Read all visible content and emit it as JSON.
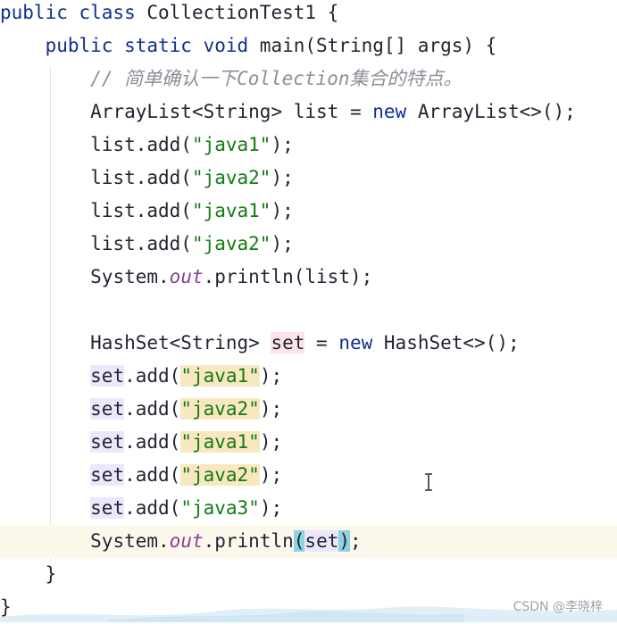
{
  "code": {
    "l1": {
      "kw": "public class ",
      "t": "CollectionTest1 {"
    },
    "l2": {
      "kw": "public static void ",
      "t": "main(String[] args) {"
    },
    "l3": {
      "comment": "// 简单确认一下Collection集合的特点。"
    },
    "l4": {
      "a": "ArrayList<String> list = ",
      "kw": "new",
      "b": " ArrayList<>();"
    },
    "l5": {
      "a": "list.add(",
      "s": "\"java1\"",
      "b": ");"
    },
    "l6": {
      "a": "list.add(",
      "s": "\"java2\"",
      "b": ");"
    },
    "l7": {
      "a": "list.add(",
      "s": "\"java1\"",
      "b": ");"
    },
    "l8": {
      "a": "list.add(",
      "s": "\"java2\"",
      "b": ");"
    },
    "l9": {
      "a": "System.",
      "f": "out",
      "b": ".println(list);"
    },
    "l11": {
      "a": "HashSet<String> ",
      "v": "set",
      "b": " = ",
      "kw": "new",
      "c": " HashSet<>();"
    },
    "l12": {
      "v": "set",
      "a": ".add(",
      "s": "\"java1\"",
      "b": ");"
    },
    "l13": {
      "v": "set",
      "a": ".add(",
      "s": "\"java2\"",
      "b": ");"
    },
    "l14": {
      "v": "set",
      "a": ".add(",
      "s": "\"java1\"",
      "b": ");"
    },
    "l15": {
      "v": "set",
      "a": ".add(",
      "s": "\"java2\"",
      "b": ");"
    },
    "l16": {
      "v": "set",
      "a": ".add(",
      "s": "\"java3\"",
      "b": ");"
    },
    "l17": {
      "a": "System.",
      "f": "out",
      "b": ".println",
      "p1": "(",
      "v": "set",
      "p2": ")",
      "e": ";"
    },
    "l18": {
      "t": "}"
    },
    "l19": {
      "t": "}"
    }
  },
  "watermark": "CSDN @李晓梓",
  "colors": {
    "keyword": "#0f2f8f",
    "string": "#137b13",
    "comment": "#8b8f99",
    "field": "#8a3e96",
    "current_line": "#fdf8ec"
  }
}
